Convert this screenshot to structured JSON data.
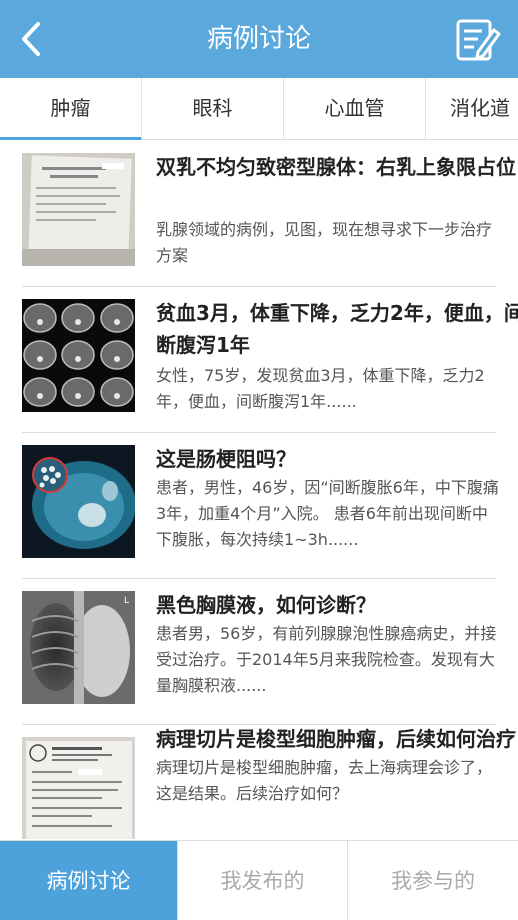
{
  "header": {
    "title": "病例讨论",
    "back_icon": "chevron-left-icon",
    "compose_icon": "edit-note-icon"
  },
  "tabs": [
    {
      "label": "肿瘤",
      "active": true
    },
    {
      "label": "眼科",
      "active": false
    },
    {
      "label": "心血管",
      "active": false
    },
    {
      "label": "消化道",
      "active": false
    }
  ],
  "cases": [
    {
      "title": "双乳不均匀致密型腺体：右乳上象限占位",
      "desc": "乳腺领域的病例，见图，现在想寻求下一步治疗方案"
    },
    {
      "title": "贫血3月，体重下降，乏力2年，便血，间断腹泻1年",
      "desc": "女性，75岁，发现贫血3月，体重下降，乏力2年，便血，间断腹泻1年......"
    },
    {
      "title": "这是肠梗阻吗？",
      "desc": "患者，男性，46岁，因“间断腹胀6年，中下腹痛3年，加重4个月”入院。 患者6年前出现间断中下腹胀，每次持续1~3h......"
    },
    {
      "title": "黑色胸膜液，如何诊断？",
      "desc": "患者男，56岁，有前列腺腺泡性腺癌病史，并接受过治疗。于2014年5月来我院检查。发现有大量胸膜积液......"
    },
    {
      "title": "病理切片是梭型细胞肿瘤，后续如何治疗",
      "desc": "病理切片是梭型细胞肿瘤，去上海病理会诊了，这是结果。后续治疗如何？"
    }
  ],
  "bottom_nav": [
    {
      "label": "病例讨论",
      "active": true
    },
    {
      "label": "我发布的",
      "active": false
    },
    {
      "label": "我参与的",
      "active": false
    }
  ],
  "colors": {
    "primary": "#5aa8dc",
    "active_tab": "#4da2dc"
  }
}
